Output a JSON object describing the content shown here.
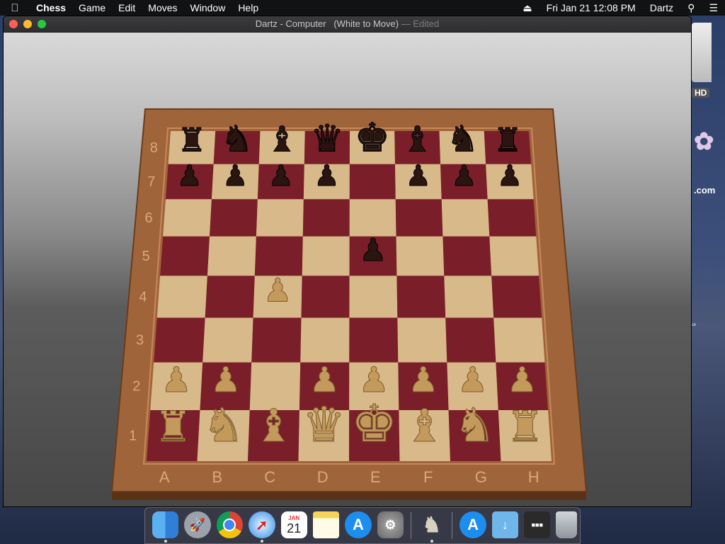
{
  "menubar": {
    "apple_icon": "apple-icon",
    "app_name": "Chess",
    "menus": [
      "Game",
      "Edit",
      "Moves",
      "Window",
      "Help"
    ],
    "date_time": "Fri Jan 21  12:08 PM",
    "user": "Dartz"
  },
  "window": {
    "title_main": "Dartz - Computer",
    "title_status": "(White to Move)",
    "title_edited": "— Edited"
  },
  "board": {
    "ranks": [
      "8",
      "7",
      "6",
      "5",
      "4",
      "3",
      "2",
      "1"
    ],
    "files": [
      "A",
      "B",
      "C",
      "D",
      "E",
      "F",
      "G",
      "H"
    ],
    "pieces": [
      {
        "color": "black",
        "type": "rook",
        "square": "a8"
      },
      {
        "color": "black",
        "type": "knight",
        "square": "b8"
      },
      {
        "color": "black",
        "type": "bishop",
        "square": "c8"
      },
      {
        "color": "black",
        "type": "queen",
        "square": "d8"
      },
      {
        "color": "black",
        "type": "king",
        "square": "e8"
      },
      {
        "color": "black",
        "type": "bishop",
        "square": "f8"
      },
      {
        "color": "black",
        "type": "knight",
        "square": "g8"
      },
      {
        "color": "black",
        "type": "rook",
        "square": "h8"
      },
      {
        "color": "black",
        "type": "pawn",
        "square": "a7"
      },
      {
        "color": "black",
        "type": "pawn",
        "square": "b7"
      },
      {
        "color": "black",
        "type": "pawn",
        "square": "c7"
      },
      {
        "color": "black",
        "type": "pawn",
        "square": "d7"
      },
      {
        "color": "black",
        "type": "pawn",
        "square": "f7"
      },
      {
        "color": "black",
        "type": "pawn",
        "square": "g7"
      },
      {
        "color": "black",
        "type": "pawn",
        "square": "h7"
      },
      {
        "color": "black",
        "type": "pawn",
        "square": "e5"
      },
      {
        "color": "white",
        "type": "pawn",
        "square": "c4"
      },
      {
        "color": "white",
        "type": "pawn",
        "square": "a2"
      },
      {
        "color": "white",
        "type": "pawn",
        "square": "b2"
      },
      {
        "color": "white",
        "type": "pawn",
        "square": "d2"
      },
      {
        "color": "white",
        "type": "pawn",
        "square": "e2"
      },
      {
        "color": "white",
        "type": "pawn",
        "square": "f2"
      },
      {
        "color": "white",
        "type": "pawn",
        "square": "g2"
      },
      {
        "color": "white",
        "type": "pawn",
        "square": "h2"
      },
      {
        "color": "white",
        "type": "rook",
        "square": "a1"
      },
      {
        "color": "white",
        "type": "knight",
        "square": "b1"
      },
      {
        "color": "white",
        "type": "bishop",
        "square": "c1"
      },
      {
        "color": "white",
        "type": "queen",
        "square": "d1"
      },
      {
        "color": "white",
        "type": "king",
        "square": "e1"
      },
      {
        "color": "white",
        "type": "bishop",
        "square": "f1"
      },
      {
        "color": "white",
        "type": "knight",
        "square": "g1"
      },
      {
        "color": "white",
        "type": "rook",
        "square": "h1"
      }
    ]
  },
  "desktop": {
    "hd_label": "HD",
    "com_label": ".com"
  },
  "dock": {
    "items": [
      {
        "icon": "finder-icon",
        "running": true
      },
      {
        "icon": "launchpad-icon",
        "running": false
      },
      {
        "icon": "chrome-icon",
        "running": false
      },
      {
        "icon": "safari-icon",
        "running": true
      },
      {
        "icon": "calendar-icon",
        "running": false,
        "month": "JAN",
        "day": "21"
      },
      {
        "icon": "notes-icon",
        "running": false
      },
      {
        "icon": "app-store-icon",
        "running": false
      },
      {
        "icon": "system-preferences-icon",
        "running": false
      },
      {
        "icon": "chess-icon",
        "running": true
      },
      {
        "icon": "app-store-downloads-icon",
        "running": false
      },
      {
        "icon": "downloads-folder-icon",
        "running": false
      },
      {
        "icon": "screen-capture-icon",
        "running": false
      },
      {
        "icon": "trash-icon",
        "running": false
      }
    ]
  },
  "colors": {
    "dark_square": "#7a1e2a",
    "light_square": "#d8b98a",
    "frame": "#a0643a",
    "black_piece": "#2a1510",
    "white_piece": "#c39a5c"
  }
}
